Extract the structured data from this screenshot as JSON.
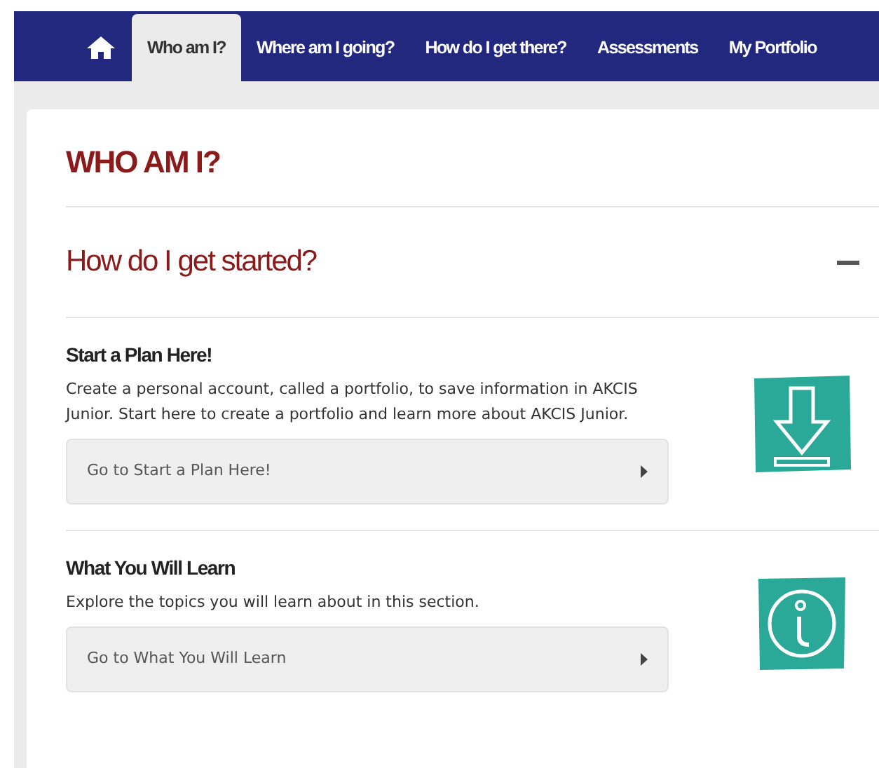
{
  "nav": {
    "tabs": [
      {
        "kind": "home",
        "selected": false
      },
      {
        "kind": "text",
        "label": "Who am I?",
        "selected": true
      },
      {
        "kind": "text",
        "label": "Where am I going?",
        "selected": false
      },
      {
        "kind": "text",
        "label": "How do I get there?",
        "selected": false
      },
      {
        "kind": "text",
        "label": "Assessments",
        "selected": false
      },
      {
        "kind": "text",
        "label": "My Portfolio",
        "selected": false
      }
    ]
  },
  "page_title": "WHO AM I?",
  "section": {
    "title": "How do I get started?",
    "expanded": true,
    "items": [
      {
        "title": "Start a Plan Here!",
        "text": "Create a personal account, called a portfolio, to save information in AKCIS Junior. Start here to create a portfolio and learn more about AKCIS Junior.",
        "link": "Go to Start a Plan Here!",
        "kind": "download"
      },
      {
        "title": "What You Will Learn",
        "text": "Explore the topics you will learn about in this section.",
        "link": "Go to What You Will Learn",
        "kind": "info"
      }
    ]
  }
}
